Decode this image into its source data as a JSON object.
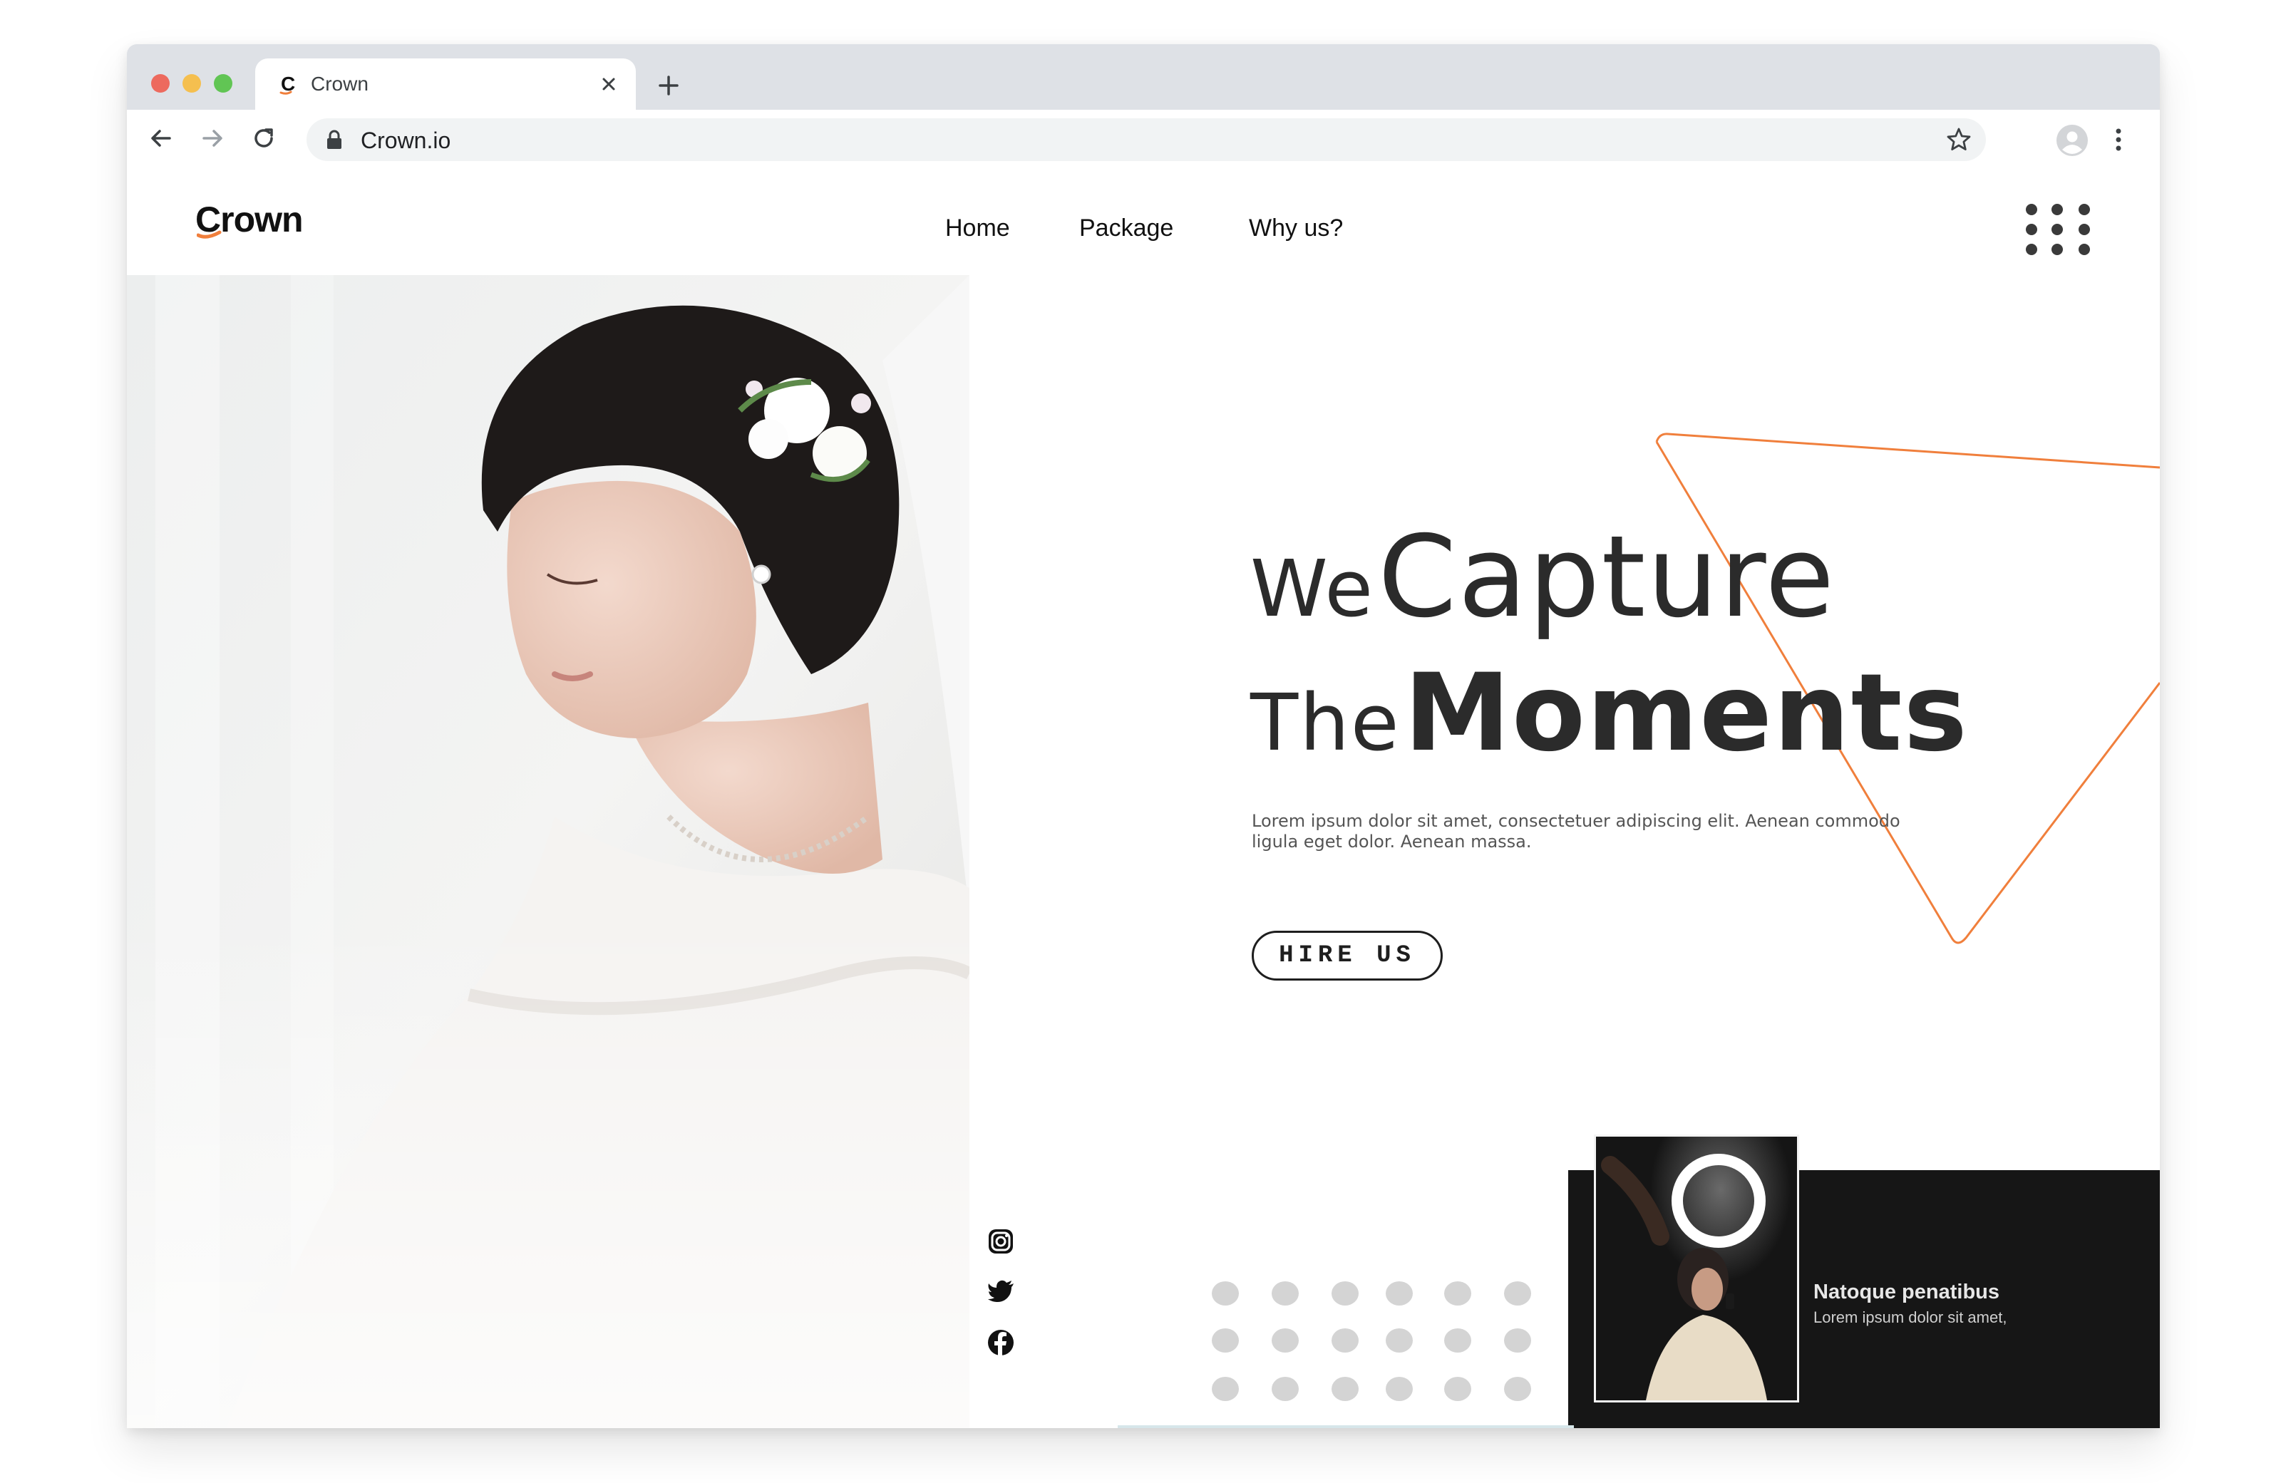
{
  "browser": {
    "tab_title": "Crown",
    "url": "Crown.io"
  },
  "site": {
    "logo": "Crown",
    "nav": [
      "Home",
      "Package",
      "Why us?"
    ]
  },
  "hero": {
    "line1_small": "We",
    "line1_big": "Capture",
    "line2_small": "The",
    "line2_big": "Moments",
    "body": "Lorem ipsum dolor sit amet, consectetuer adipiscing elit. Aenean commodo ligula eget dolor. Aenean massa.",
    "cta": "HIRE US"
  },
  "card": {
    "title": "Natoque penatibus",
    "subtitle": "Lorem ipsum dolor sit amet,"
  },
  "social": [
    "instagram-icon",
    "twitter-icon",
    "facebook-icon"
  ],
  "colors": {
    "accent": "#f07f3c",
    "dark": "#161616",
    "text": "#2b2b2b",
    "dot": "#d4d4d4"
  }
}
